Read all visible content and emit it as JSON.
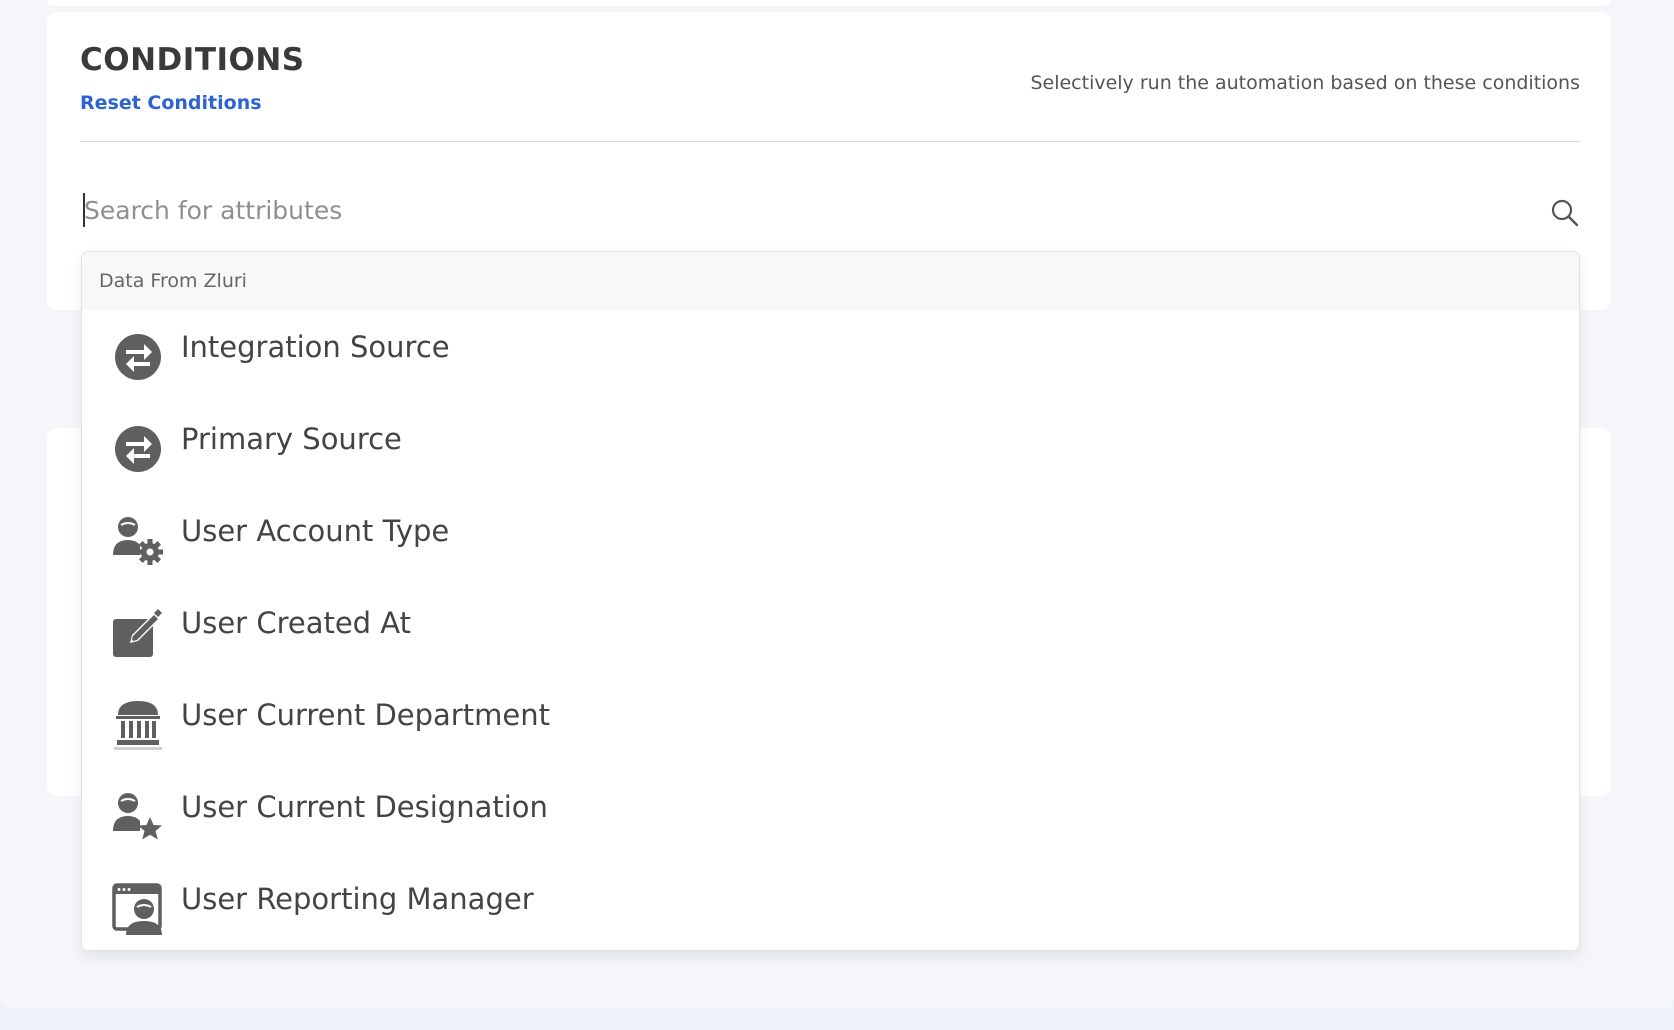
{
  "section": {
    "title": "CONDITIONS",
    "reset_label": "Reset Conditions",
    "subtitle": "Selectively run the automation based on these conditions"
  },
  "search": {
    "placeholder": "Search for attributes",
    "value": ""
  },
  "dropdown": {
    "group_header": "Data From Zluri",
    "items": [
      {
        "label": "Integration Source",
        "icon": "swap-arrows-icon"
      },
      {
        "label": "Primary Source",
        "icon": "swap-arrows-icon"
      },
      {
        "label": "User Account Type",
        "icon": "user-gear-icon"
      },
      {
        "label": "User Created At",
        "icon": "edit-square-icon"
      },
      {
        "label": "User Current Department",
        "icon": "building-columns-icon"
      },
      {
        "label": "User Current Designation",
        "icon": "user-star-icon"
      },
      {
        "label": "User Reporting Manager",
        "icon": "window-user-icon"
      }
    ]
  },
  "colors": {
    "accent": "#2d62d3",
    "icon": "#5f5f5f",
    "background": "#eef2fb"
  }
}
